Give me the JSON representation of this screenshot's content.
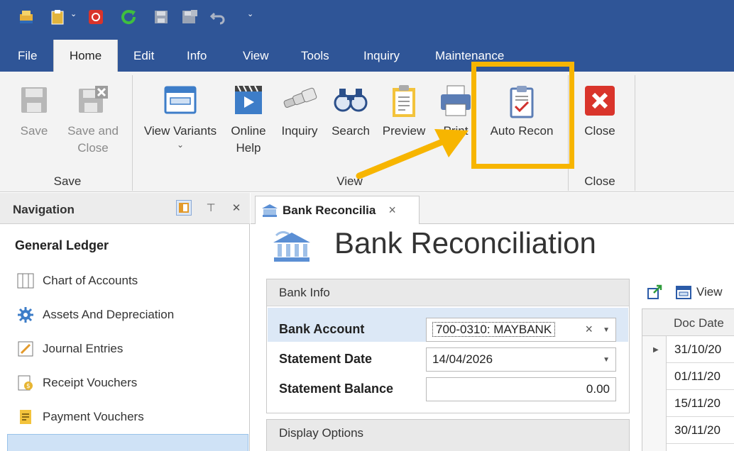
{
  "quick_access": {
    "icons": [
      "app-logo-icon",
      "clipboard-icon",
      "stop-icon",
      "refresh-icon",
      "save-icon",
      "save-close-icon",
      "undo-icon"
    ]
  },
  "menu": {
    "tabs": [
      "File",
      "Home",
      "Edit",
      "Info",
      "View",
      "Tools",
      "Inquiry",
      "Maintenance"
    ],
    "active": "Home"
  },
  "ribbon": {
    "save": {
      "label_line1": "Save"
    },
    "save_close": {
      "label_line1": "Save and",
      "label_line2": "Close"
    },
    "view_variants": {
      "label": "View Variants",
      "caret": "⌄"
    },
    "online_help": {
      "label_line1": "Online",
      "label_line2": "Help"
    },
    "inquiry": {
      "label": "Inquiry"
    },
    "search": {
      "label": "Search"
    },
    "preview": {
      "label": "Preview"
    },
    "print": {
      "label": "Print"
    },
    "auto_recon": {
      "label": "Auto Recon"
    },
    "close": {
      "label": "Close"
    },
    "groups": {
      "save": "Save",
      "view": "View",
      "close": "Close"
    }
  },
  "navigation": {
    "title": "Navigation",
    "section": "General Ledger",
    "items": [
      {
        "label": "Chart of Accounts",
        "icon": "chart-of-accounts-icon"
      },
      {
        "label": "Assets And Depreciation",
        "icon": "gear-icon"
      },
      {
        "label": "Journal Entries",
        "icon": "journal-icon"
      },
      {
        "label": "Receipt Vouchers",
        "icon": "receipt-icon"
      },
      {
        "label": "Payment Vouchers",
        "icon": "payment-icon"
      }
    ]
  },
  "document_tab": {
    "label": "Bank Reconcilia",
    "close": "×"
  },
  "page": {
    "title": "Bank Reconciliation",
    "bank_info": {
      "header": "Bank Info",
      "bank_account_label": "Bank Account",
      "bank_account_value": "700-0310: MAYBANK",
      "statement_date_label": "Statement Date",
      "statement_date_value": "14/04/2026",
      "statement_balance_label": "Statement Balance",
      "statement_balance_value": "0.00"
    },
    "display_options": {
      "header": "Display Options"
    },
    "grid_tools": {
      "view_label": "View"
    },
    "grid": {
      "header": "Doc Date",
      "rows": [
        "31/10/20",
        "01/11/20",
        "15/11/20",
        "30/11/20"
      ]
    }
  },
  "colors": {
    "title_bar": "#2f5597",
    "ribbon_bg": "#f3f3f3",
    "highlight": "#f7b500",
    "selected_row": "#dce8f6"
  }
}
